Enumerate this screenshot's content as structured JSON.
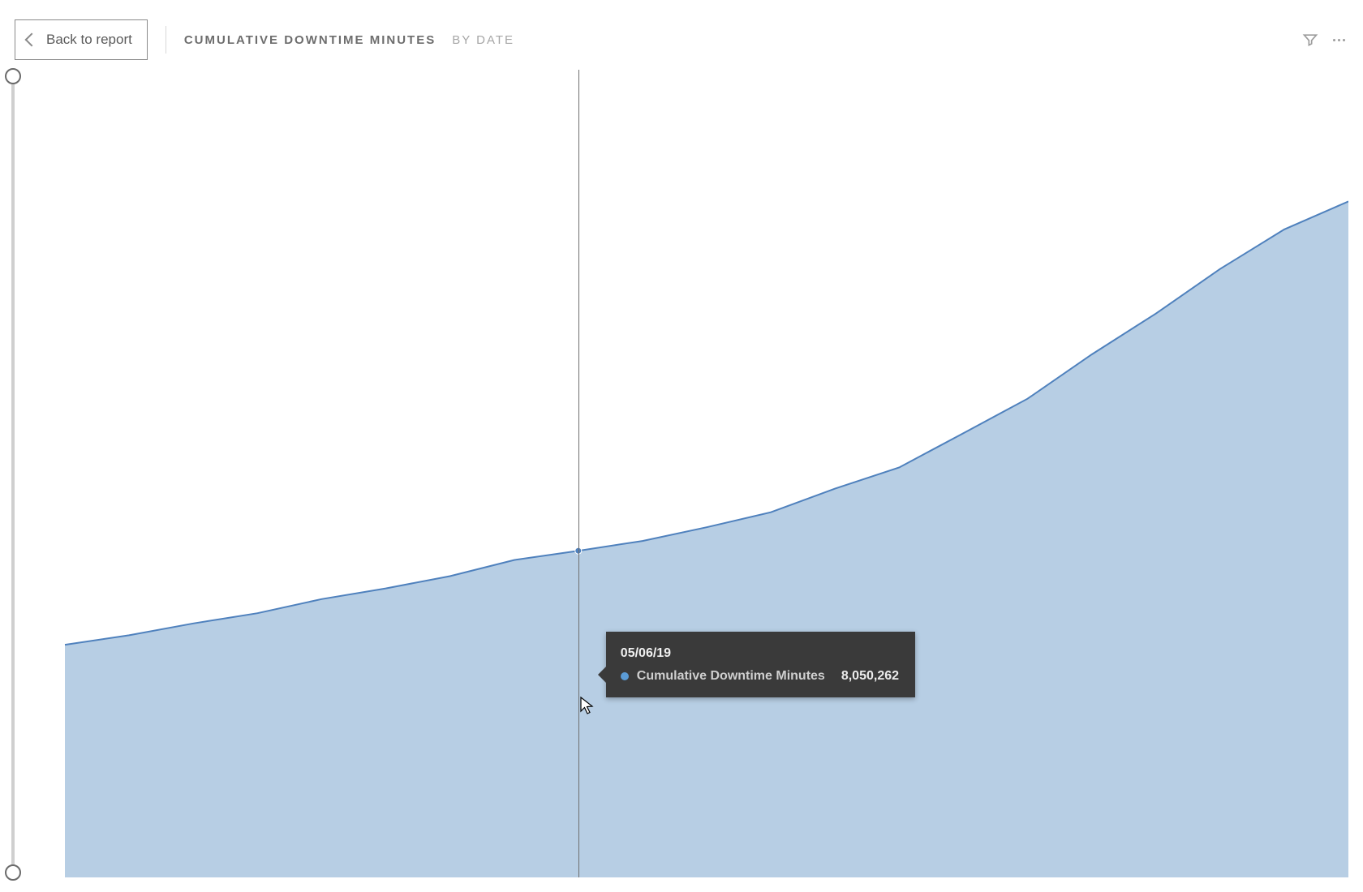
{
  "header": {
    "back_label": "Back to report",
    "title_main": "CUMULATIVE DOWNTIME MINUTES",
    "title_sub": "BY DATE"
  },
  "colors": {
    "area_fill": "#b7cee4",
    "area_stroke": "#4f81bd",
    "tooltip_bg": "#3a3a3a",
    "tooltip_marker": "#5b9bd5"
  },
  "tooltip": {
    "date": "05/06/19",
    "series_label": "Cumulative Downtime Minutes",
    "value": "8,050,262"
  },
  "chart_data": {
    "type": "area",
    "title": "Cumulative Downtime Minutes by Date",
    "xlabel": "Date",
    "ylabel": "Cumulative Downtime Minutes",
    "ylim": [
      0,
      20000000
    ],
    "series": [
      {
        "name": "Cumulative Downtime Minutes",
        "color": "#4f81bd",
        "points": [
          {
            "x": 0.0,
            "y": 5700000
          },
          {
            "x": 0.05,
            "y": 6000000
          },
          {
            "x": 0.1,
            "y": 6300000
          },
          {
            "x": 0.15,
            "y": 6600000
          },
          {
            "x": 0.2,
            "y": 6900000
          },
          {
            "x": 0.25,
            "y": 7200000
          },
          {
            "x": 0.3,
            "y": 7500000
          },
          {
            "x": 0.35,
            "y": 7800000
          },
          {
            "x": 0.4,
            "y": 8050262,
            "label": "05/06/19"
          },
          {
            "x": 0.45,
            "y": 8350000
          },
          {
            "x": 0.5,
            "y": 8700000
          },
          {
            "x": 0.55,
            "y": 9100000
          },
          {
            "x": 0.6,
            "y": 9600000
          },
          {
            "x": 0.65,
            "y": 10200000
          },
          {
            "x": 0.7,
            "y": 11000000
          },
          {
            "x": 0.75,
            "y": 11900000
          },
          {
            "x": 0.8,
            "y": 12900000
          },
          {
            "x": 0.85,
            "y": 14000000
          },
          {
            "x": 0.9,
            "y": 15100000
          },
          {
            "x": 0.95,
            "y": 16000000
          },
          {
            "x": 1.0,
            "y": 16700000
          }
        ]
      }
    ],
    "hover_index": 8
  }
}
